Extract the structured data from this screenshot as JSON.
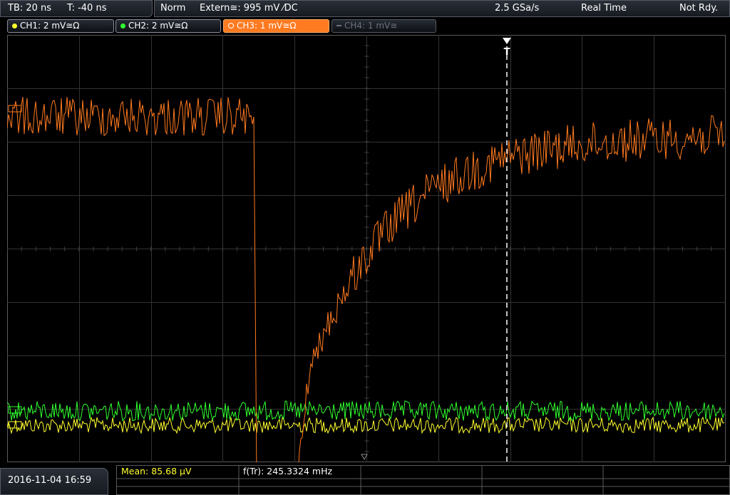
{
  "topbar": {
    "timebase": "TB: 20 ns",
    "trigger_time": "T: -40 ns",
    "trigger_mode": "Norm",
    "trigger_source": "Extern≅: 995 mV ⁄DC",
    "sample_rate": "2.5 GSa/s",
    "acq_mode": "Real Time",
    "status": "Not Rdy."
  },
  "channels": [
    {
      "label": "CH1: 2 mV≅Ω",
      "color": "#ffff30"
    },
    {
      "label": "CH2: 2 mV≅Ω",
      "color": "#30ff30"
    },
    {
      "label": "CH3: 1 mV≅Ω",
      "color": "#ff7a20"
    },
    {
      "label": "CH4: 1 mV≅",
      "color": "#6a6f78"
    }
  ],
  "trigger_marker": "T",
  "bottom": {
    "datetime": "2016-11-04 16:59",
    "mean": "Mean: 85.68 µV",
    "freq": "f(Tr): 245.3324 mHz"
  },
  "colors": {
    "grid": "#3c3c3c",
    "ch1": "#ffff30",
    "ch2": "#30ff30",
    "ch3": "#ff7a20"
  }
}
